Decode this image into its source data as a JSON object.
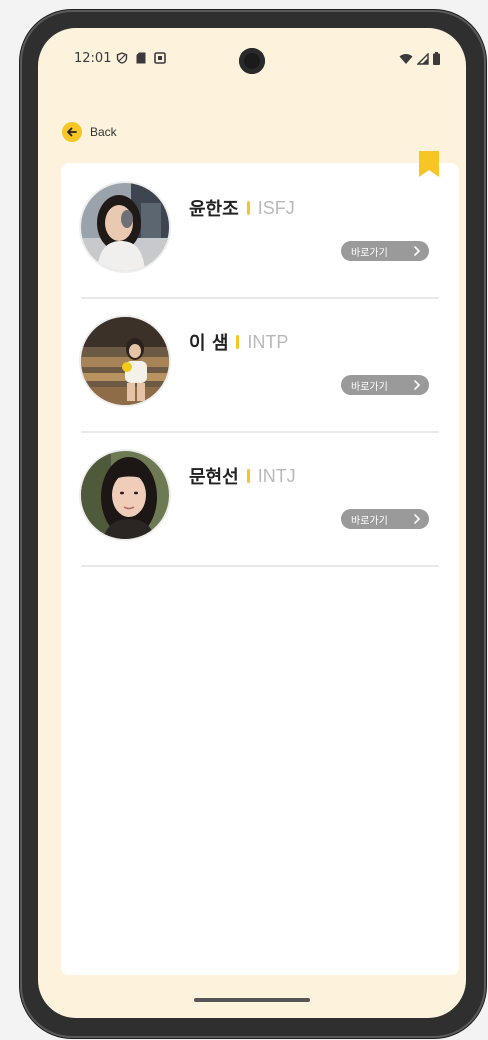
{
  "status_bar": {
    "time": "12:01"
  },
  "nav": {
    "back_label": "Back"
  },
  "colors": {
    "accent": "#f7c625",
    "background": "#fdf3dd",
    "card": "#ffffff",
    "button": "#9a9a9a"
  },
  "people": [
    {
      "name": "윤한조",
      "mbti": "ISFJ",
      "button_label": "바로가기"
    },
    {
      "name": "이 샘",
      "mbti": "INTP",
      "button_label": "바로가기"
    },
    {
      "name": "문현선",
      "mbti": "INTJ",
      "button_label": "바로가기"
    }
  ]
}
